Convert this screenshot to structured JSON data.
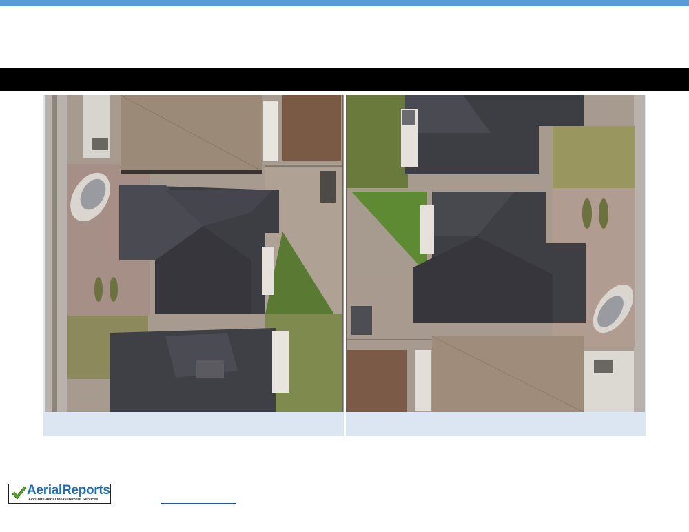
{
  "header": {
    "title": "",
    "accent_color": "#5b9bd5",
    "bar_color": "#000000"
  },
  "figure": {
    "panels": [
      {
        "view": "aerial-left",
        "caption": ""
      },
      {
        "view": "aerial-right",
        "caption": ""
      }
    ],
    "caption_bg_color": "#dce6f2"
  },
  "footer": {
    "logo": {
      "wordmark": "AerialReports",
      "tagline": "Accurate Aerial Measurement Services",
      "brand_color": "#1f6fb6"
    },
    "link_text": ""
  }
}
